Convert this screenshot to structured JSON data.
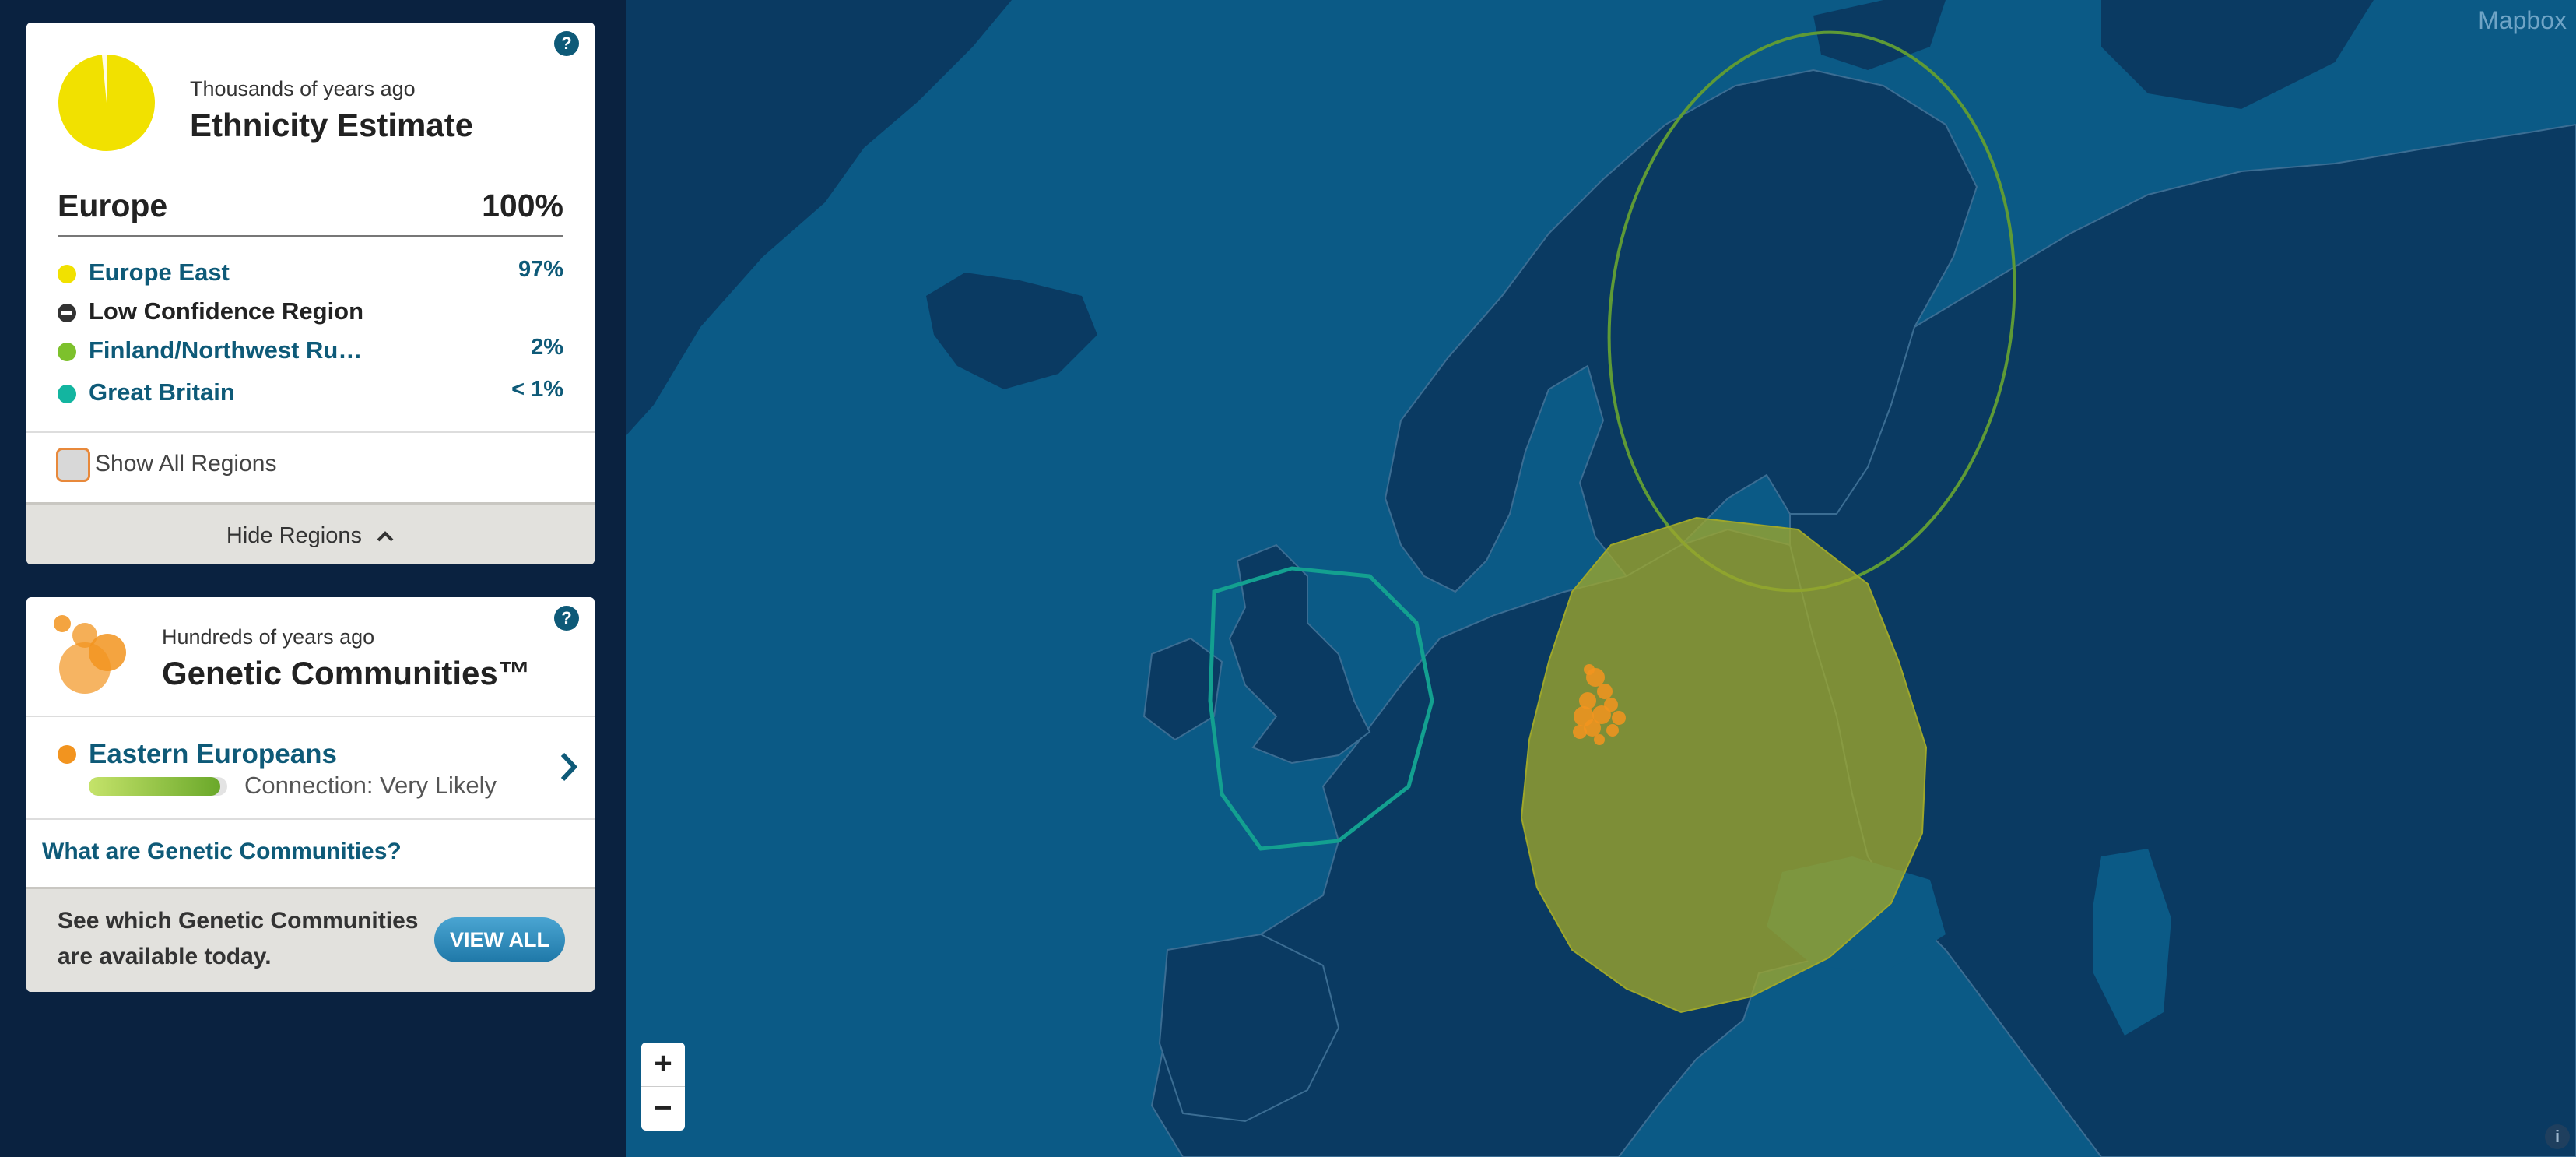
{
  "ethnicity": {
    "time_scale": "Thousands of years ago",
    "title": "Ethnicity Estimate",
    "region": "Europe",
    "region_pct": "100%",
    "subregions": [
      {
        "label": "Europe East",
        "pct": "97%",
        "color": "#f1e100"
      },
      {
        "label": "Low Confidence Region",
        "pct": "",
        "color": "#333333"
      },
      {
        "label": "Finland/Northwest Ru…",
        "pct": "2%",
        "color": "#7dc12c"
      },
      {
        "label": "Great Britain",
        "pct": "< 1%",
        "color": "#13b5a0"
      }
    ],
    "show_all_label": "Show All Regions",
    "show_all_checked": false,
    "hide_regions_label": "Hide Regions",
    "help": "?",
    "pie": {
      "Europe East": 97,
      "other": 3
    }
  },
  "communities": {
    "time_scale": "Hundreds of years ago",
    "title": "Genetic Communities™",
    "help": "?",
    "community": {
      "name": "Eastern Europeans",
      "connection": "Connection: Very Likely",
      "color": "#f2941f",
      "level": 0.95
    },
    "link": "What are Genetic Communities?",
    "footer_text_1": "See which Genetic Communities",
    "footer_text_2": "are available today.",
    "view_all": "VIEW ALL"
  },
  "map": {
    "attribution": "Mapbox",
    "zoom_in": "+",
    "zoom_out": "−",
    "info": "i"
  },
  "colors": {
    "sea": "#0b5a86",
    "land": "#0a3a62",
    "accent": "#0e5a78",
    "button": "#2f8ebd"
  }
}
